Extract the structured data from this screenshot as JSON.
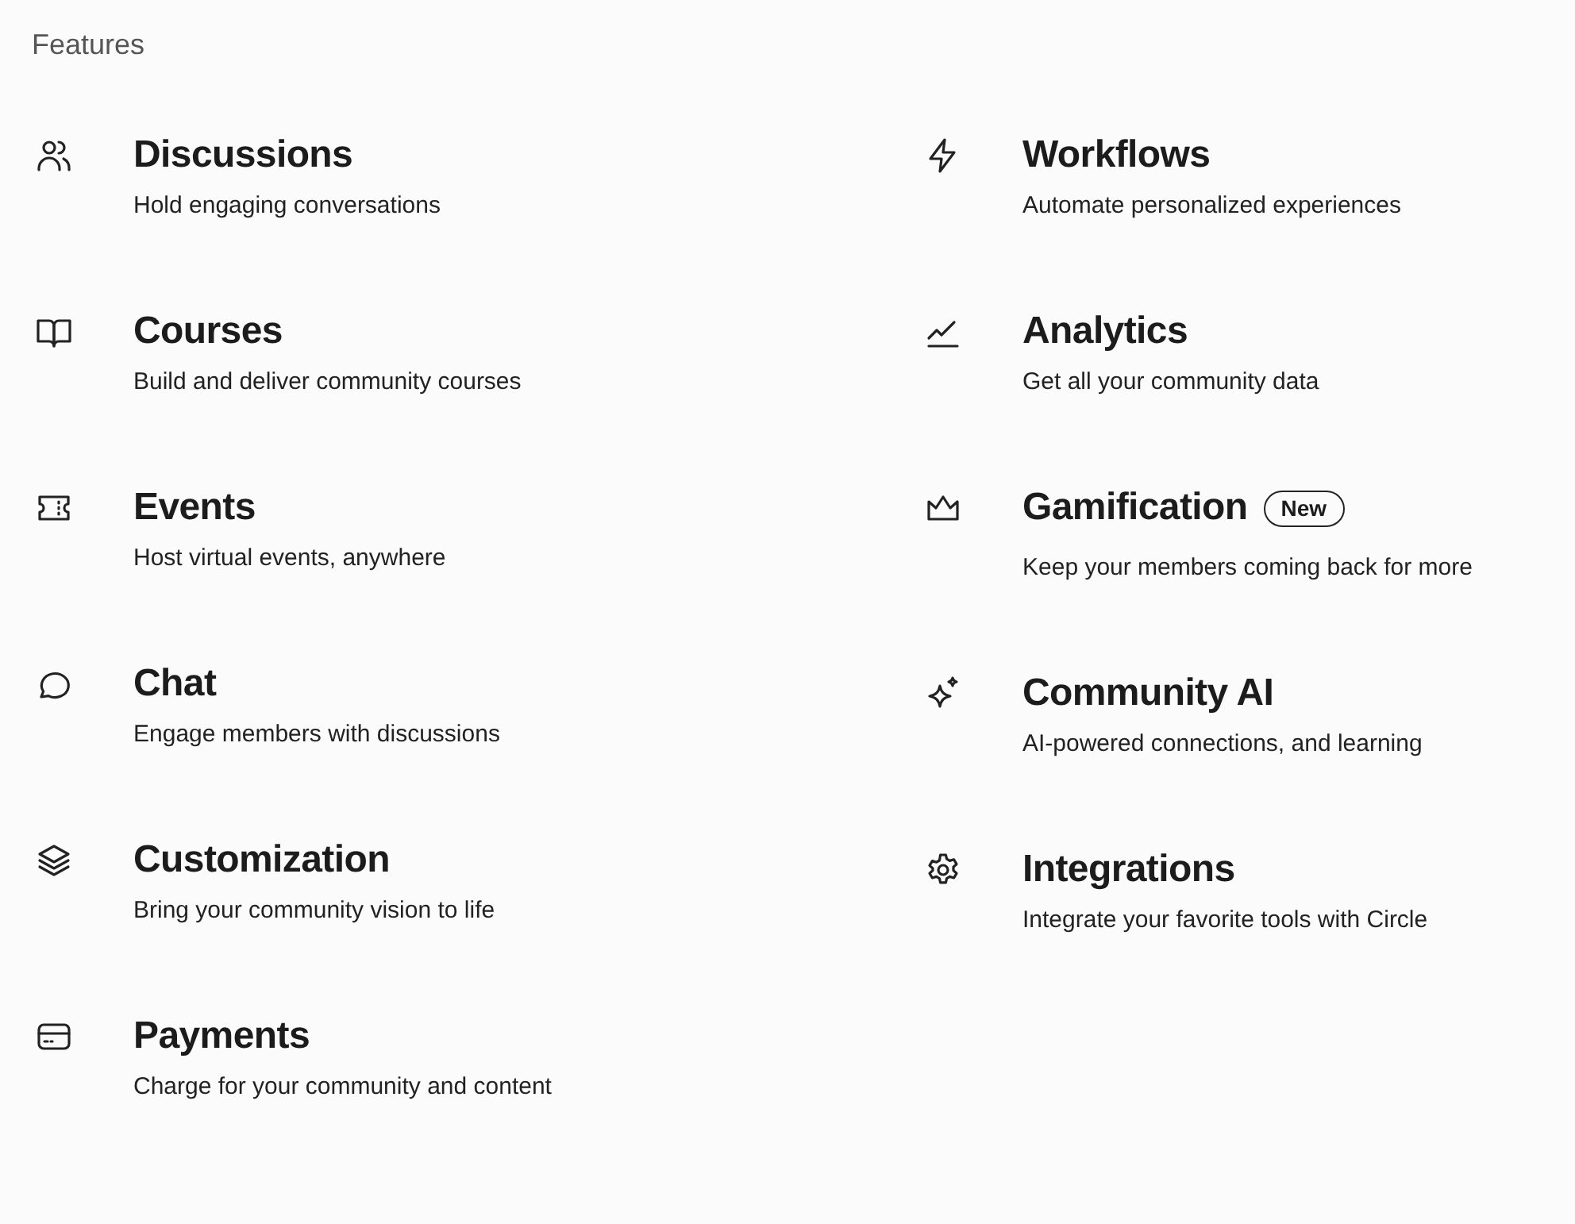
{
  "section_title": "Features",
  "columns": [
    [
      {
        "title": "Discussions",
        "description": "Hold engaging conversations"
      },
      {
        "title": "Courses",
        "description": "Build and deliver community courses"
      },
      {
        "title": "Events",
        "description": "Host virtual events, anywhere"
      },
      {
        "title": "Chat",
        "description": "Engage members with discussions"
      },
      {
        "title": "Customization",
        "description": "Bring your community vision to life"
      },
      {
        "title": "Payments",
        "description": "Charge for your community and content"
      }
    ],
    [
      {
        "title": "Workflows",
        "description": "Automate personalized experiences"
      },
      {
        "title": "Analytics",
        "description": "Get all your community data"
      },
      {
        "title": "Gamification",
        "badge": "New",
        "description": "Keep your members coming back for more"
      },
      {
        "title": "Community AI",
        "description": "AI-powered connections, and learning"
      },
      {
        "title": "Integrations",
        "description": "Integrate your favorite tools with Circle"
      }
    ]
  ]
}
